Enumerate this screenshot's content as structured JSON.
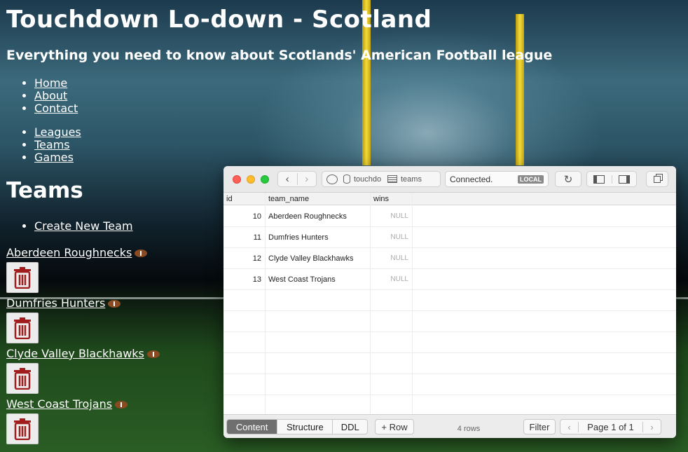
{
  "site": {
    "title": "Touchdown Lo-down - Scotland",
    "subtitle": "Everything you need to know about Scotlands' American Football league",
    "nav_main": [
      "Home",
      "About",
      "Contact"
    ],
    "nav_data": [
      "Leagues",
      "Teams",
      "Games"
    ],
    "section_title": "Teams",
    "create_label": "Create New Team",
    "teams": [
      "Aberdeen Roughnecks",
      "Dumfries Hunters",
      "Clyde Valley Blackhawks",
      "West Coast Trojans"
    ],
    "team_icon": "football-icon",
    "delete_icon": "trash-icon",
    "delete_color": "#a11d1d"
  },
  "db": {
    "database": "touchdo",
    "table": "teams",
    "status": "Connected.",
    "badge": "LOCAL",
    "columns": [
      "id",
      "team_name",
      "wins"
    ],
    "rows": [
      {
        "id": "10",
        "team_name": "Aberdeen Roughnecks",
        "wins": "NULL"
      },
      {
        "id": "11",
        "team_name": "Dumfries Hunters",
        "wins": "NULL"
      },
      {
        "id": "12",
        "team_name": "Clyde Valley Blackhawks",
        "wins": "NULL"
      },
      {
        "id": "13",
        "team_name": "West Coast Trojans",
        "wins": "NULL"
      }
    ],
    "tabs": [
      "Content",
      "Structure",
      "DDL"
    ],
    "active_tab": "Content",
    "add_row": "+ Row",
    "row_count": "4 rows",
    "filter": "Filter",
    "page": "Page 1 of 1"
  }
}
